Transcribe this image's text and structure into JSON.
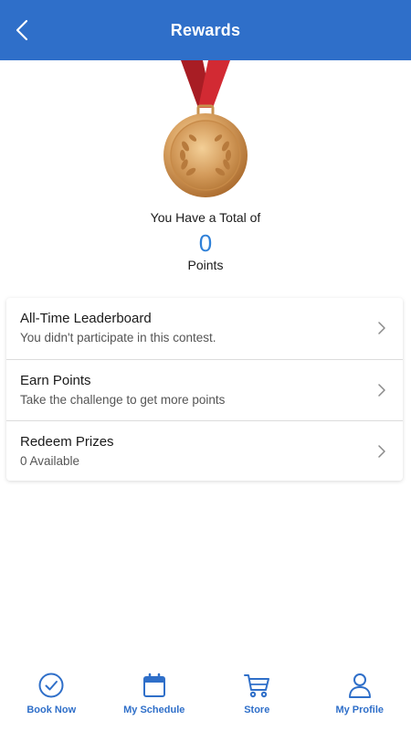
{
  "header": {
    "title": "Rewards",
    "back_icon": "chevron-left-icon"
  },
  "rewards": {
    "medal_icon": "medal-icon",
    "total_label": "You Have a Total of",
    "points_value": "0",
    "points_label": "Points"
  },
  "list": {
    "items": [
      {
        "title": "All-Time Leaderboard",
        "subtitle": "You didn't participate in this contest."
      },
      {
        "title": "Earn Points",
        "subtitle": "Take the challenge to get more points"
      },
      {
        "title": "Redeem Prizes",
        "subtitle": "0 Available"
      }
    ]
  },
  "bottom_nav": {
    "items": [
      {
        "label": "Book Now",
        "icon": "check-circle-icon"
      },
      {
        "label": "My Schedule",
        "icon": "calendar-icon"
      },
      {
        "label": "Store",
        "icon": "cart-icon"
      },
      {
        "label": "My Profile",
        "icon": "person-icon"
      }
    ]
  },
  "colors": {
    "brand_blue": "#2f6fc9",
    "points_blue": "#2f80d8",
    "ribbon_red": "#c8262e",
    "medal_gold": "#d9a266"
  }
}
